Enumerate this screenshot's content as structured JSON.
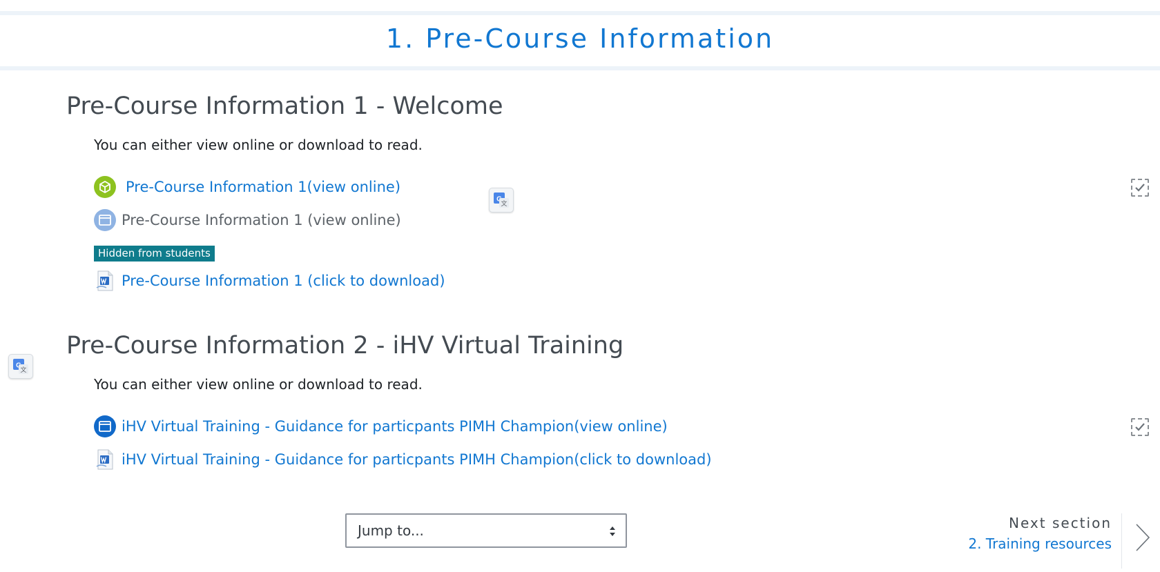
{
  "section": {
    "title": "1. Pre-Course Information"
  },
  "subsections": [
    {
      "heading": "Pre-Course Information 1 - Welcome",
      "description": "You can either view online or download to read.",
      "activities": [
        {
          "label": "Pre-Course Information 1(view online)",
          "icon": "scorm-package-icon"
        },
        {
          "label": "Pre-Course Information 1 (view online)",
          "icon": "page-icon",
          "hidden_badge": "Hidden from students"
        },
        {
          "label": "Pre-Course Information 1 (click to download)",
          "icon": "word-document-icon"
        }
      ]
    },
    {
      "heading": "Pre-Course Information 2 - iHV Virtual Training",
      "description": "You can either view online or download to read.",
      "activities": [
        {
          "label": "iHV Virtual Training - Guidance for particpants PIMH Champion(view online)",
          "icon": "page-icon"
        },
        {
          "label": "iHV Virtual Training - Guidance for particpants PIMH Champion(click to download)",
          "icon": "word-document-icon"
        }
      ]
    }
  ],
  "navigation": {
    "jump_to": "Jump to...",
    "next_label": "Next section",
    "next_link": "2. Training resources"
  },
  "colors": {
    "link": "#1177d1",
    "heading": "#444b52",
    "badge": "#0f7c8c",
    "scorm_icon": "#8dc21f",
    "page_icon_active": "#1169c9",
    "page_icon_dimmed": "#8fb3e3"
  }
}
